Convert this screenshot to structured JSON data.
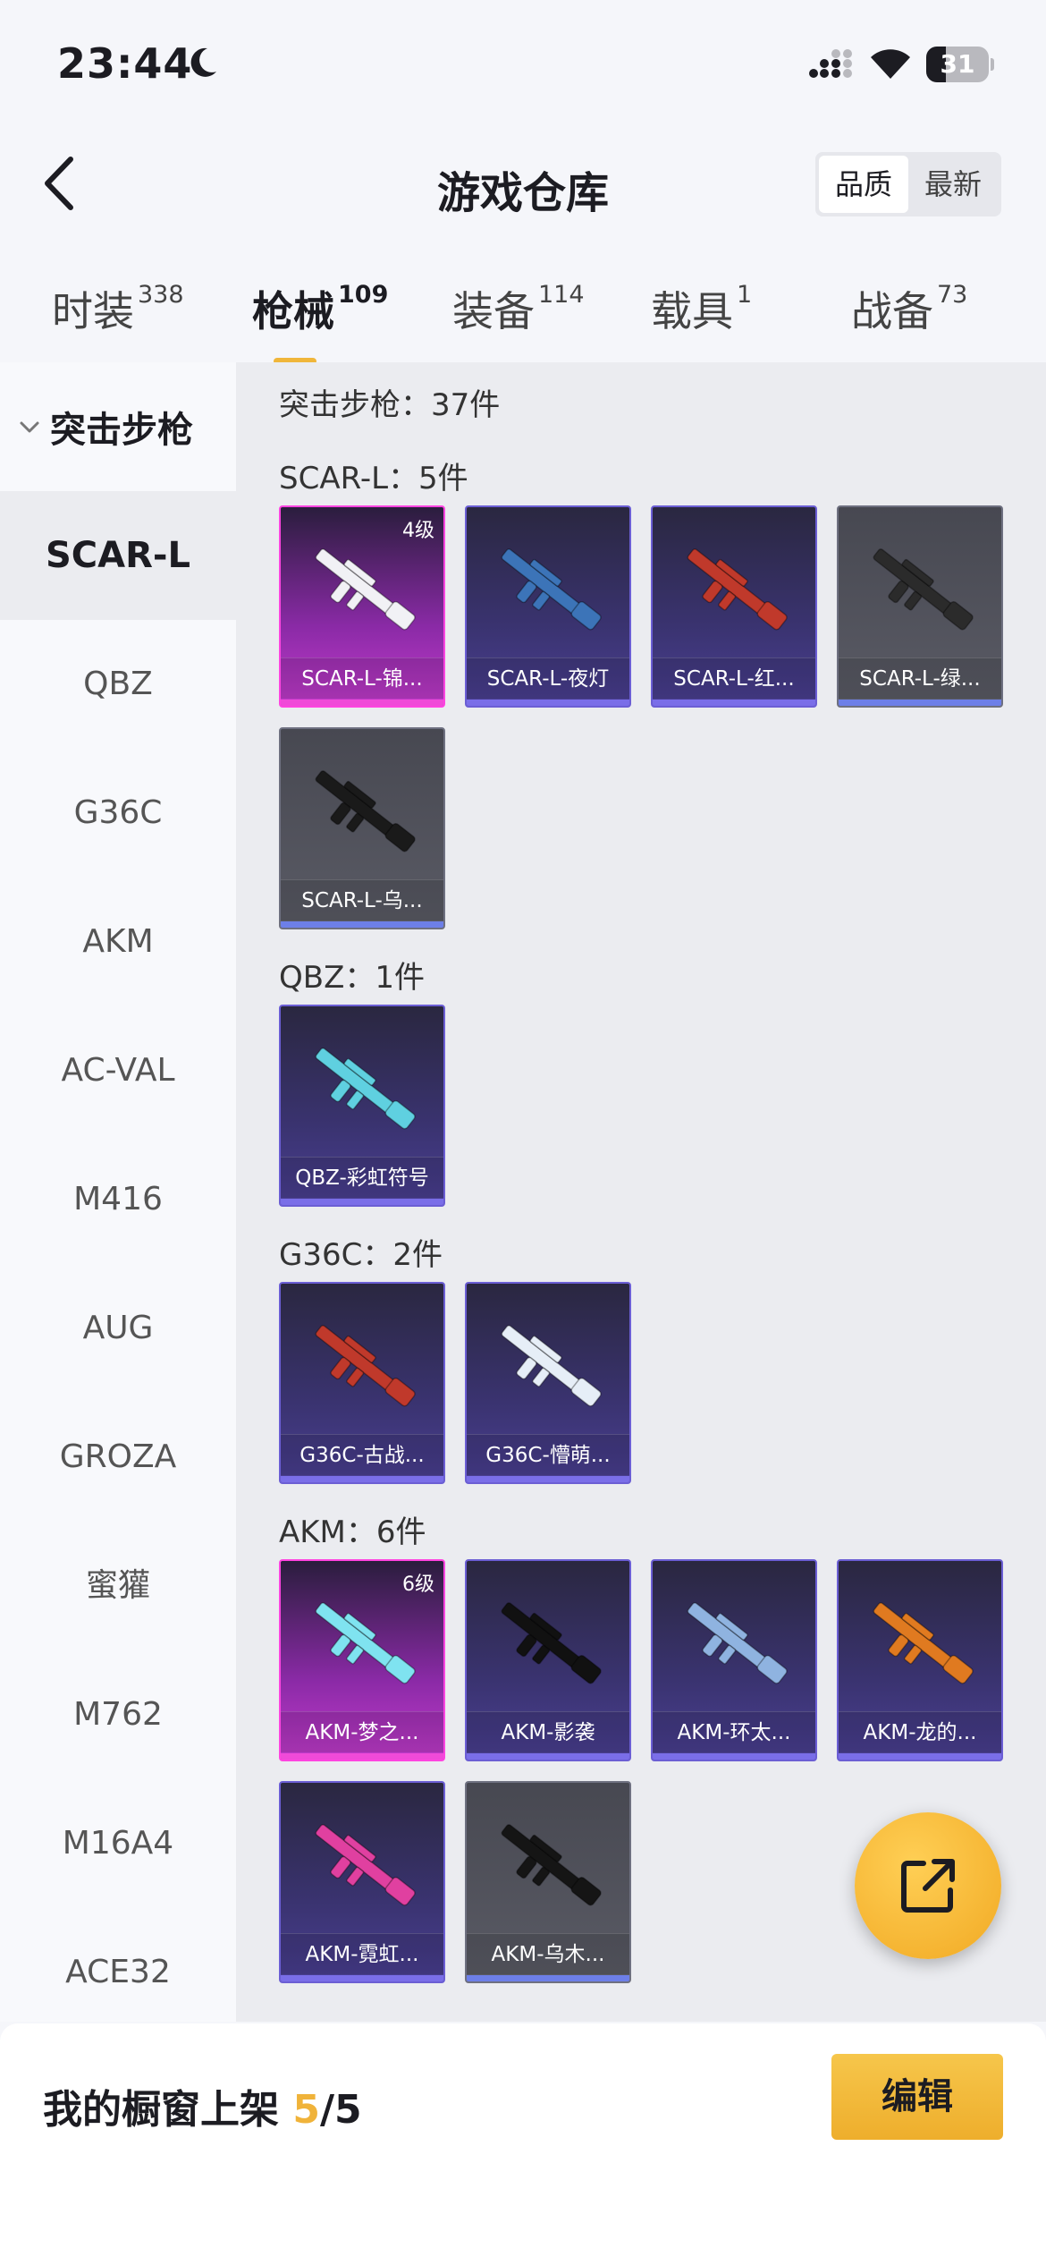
{
  "status_bar": {
    "time": "23:44",
    "battery": "31",
    "battery_level": 0.31
  },
  "nav": {
    "title": "游戏仓库",
    "sort_options": [
      "品质",
      "最新"
    ],
    "sort_selected": "品质"
  },
  "tabs": [
    {
      "label": "时装",
      "count": "338"
    },
    {
      "label": "枪械",
      "count": "109",
      "active": true
    },
    {
      "label": "装备",
      "count": "114"
    },
    {
      "label": "载具",
      "count": "1"
    },
    {
      "label": "战备",
      "count": "73"
    }
  ],
  "sidebar": {
    "group_label": "突击步枪",
    "items": [
      "SCAR-L",
      "QBZ",
      "G36C",
      "AKM",
      "AC-VAL",
      "M416",
      "AUG",
      "GROZA",
      "蜜獾",
      "M762",
      "M16A4",
      "ACE32"
    ],
    "active": "SCAR-L"
  },
  "main": {
    "category_count": "突击步枪：37件",
    "groups": [
      {
        "heading": "SCAR-L：5件",
        "items": [
          {
            "name": "SCAR-L-锦...",
            "level": "4级",
            "quality": "pink",
            "gun_color": "#f1f1f5"
          },
          {
            "name": "SCAR-L-夜灯",
            "quality": "purple",
            "gun_color": "#3c74b8"
          },
          {
            "name": "SCAR-L-红...",
            "quality": "purple",
            "gun_color": "#c0392b"
          },
          {
            "name": "SCAR-L-绿...",
            "quality": "grey",
            "gun_color": "#2b2b2b"
          },
          {
            "name": "SCAR-L-乌...",
            "quality": "grey",
            "gun_color": "#1a1a1a"
          }
        ]
      },
      {
        "heading": "QBZ：1件",
        "items": [
          {
            "name": "QBZ-彩虹符号",
            "quality": "purple",
            "gun_color": "#5fd0e0"
          }
        ]
      },
      {
        "heading": "G36C：2件",
        "items": [
          {
            "name": "G36C-古战...",
            "quality": "purple",
            "gun_color": "#c0392b"
          },
          {
            "name": "G36C-懵萌...",
            "quality": "purple",
            "gun_color": "#e6eef7"
          }
        ]
      },
      {
        "heading": "AKM：6件",
        "items": [
          {
            "name": "AKM-梦之...",
            "level": "6级",
            "quality": "pink",
            "gun_color": "#7fe3f0"
          },
          {
            "name": "AKM-影袭",
            "quality": "purple",
            "gun_color": "#111111"
          },
          {
            "name": "AKM-环太...",
            "quality": "purple",
            "gun_color": "#8fb3e0"
          },
          {
            "name": "AKM-龙的...",
            "quality": "purple",
            "gun_color": "#e07a20"
          },
          {
            "name": "AKM-霓虹...",
            "quality": "purple",
            "gun_color": "#e040a0"
          },
          {
            "name": "AKM-乌木...",
            "quality": "grey",
            "gun_color": "#151515"
          }
        ]
      }
    ]
  },
  "bottom_bar": {
    "showcase_label": "我的橱窗上架",
    "showcase_current": "5",
    "showcase_total": "/5",
    "edit_label": "编辑"
  },
  "colors": {
    "accent": "#f0b33a",
    "pink_quality": "#ff44e0",
    "purple_quality": "#6b5ed4",
    "grey_quality": "#6e7080"
  }
}
